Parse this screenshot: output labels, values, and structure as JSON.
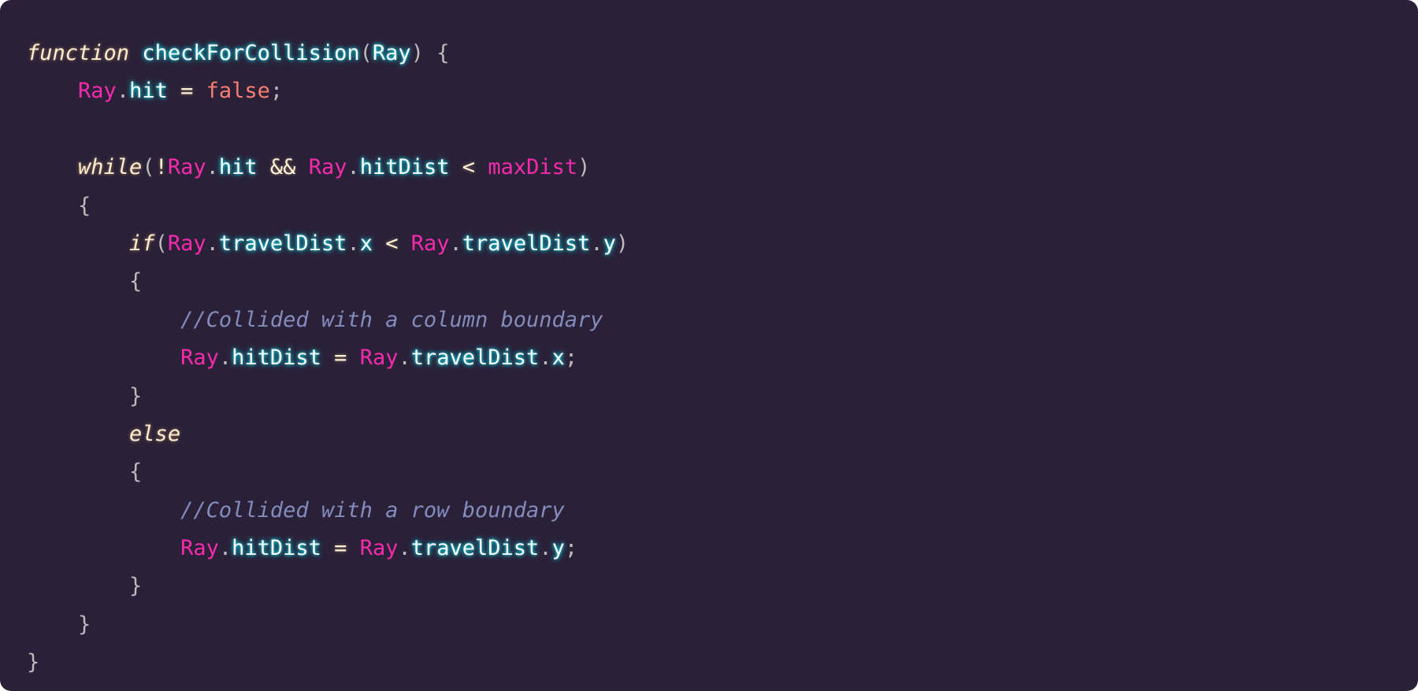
{
  "code": {
    "lines": [
      [
        {
          "t": "function",
          "c": "kw"
        },
        {
          "t": " ",
          "c": "punc"
        },
        {
          "t": "checkForCollision",
          "c": "fn"
        },
        {
          "t": "(",
          "c": "punc"
        },
        {
          "t": "Ray",
          "c": "param"
        },
        {
          "t": ") {",
          "c": "punc"
        }
      ],
      [
        {
          "t": "    ",
          "c": "punc"
        },
        {
          "t": "Ray",
          "c": "obj"
        },
        {
          "t": ".",
          "c": "punc"
        },
        {
          "t": "hit",
          "c": "prop"
        },
        {
          "t": " = ",
          "c": "op"
        },
        {
          "t": "false",
          "c": "bool"
        },
        {
          "t": ";",
          "c": "punc"
        }
      ],
      [],
      [
        {
          "t": "    ",
          "c": "punc"
        },
        {
          "t": "while",
          "c": "kw"
        },
        {
          "t": "(",
          "c": "punc"
        },
        {
          "t": "!",
          "c": "op"
        },
        {
          "t": "Ray",
          "c": "obj"
        },
        {
          "t": ".",
          "c": "punc"
        },
        {
          "t": "hit",
          "c": "prop"
        },
        {
          "t": " && ",
          "c": "op"
        },
        {
          "t": "Ray",
          "c": "obj"
        },
        {
          "t": ".",
          "c": "punc"
        },
        {
          "t": "hitDist",
          "c": "prop"
        },
        {
          "t": " < ",
          "c": "op"
        },
        {
          "t": "maxDist",
          "c": "ident"
        },
        {
          "t": ")",
          "c": "punc"
        }
      ],
      [
        {
          "t": "    {",
          "c": "punc"
        }
      ],
      [
        {
          "t": "        ",
          "c": "punc"
        },
        {
          "t": "if",
          "c": "kw"
        },
        {
          "t": "(",
          "c": "punc"
        },
        {
          "t": "Ray",
          "c": "obj"
        },
        {
          "t": ".",
          "c": "punc"
        },
        {
          "t": "travelDist",
          "c": "prop"
        },
        {
          "t": ".",
          "c": "punc"
        },
        {
          "t": "x",
          "c": "prop"
        },
        {
          "t": " < ",
          "c": "op"
        },
        {
          "t": "Ray",
          "c": "obj"
        },
        {
          "t": ".",
          "c": "punc"
        },
        {
          "t": "travelDist",
          "c": "prop"
        },
        {
          "t": ".",
          "c": "punc"
        },
        {
          "t": "y",
          "c": "prop"
        },
        {
          "t": ")",
          "c": "punc"
        }
      ],
      [
        {
          "t": "        {",
          "c": "punc"
        }
      ],
      [
        {
          "t": "            ",
          "c": "punc"
        },
        {
          "t": "//Collided with a column boundary",
          "c": "comment"
        }
      ],
      [
        {
          "t": "            ",
          "c": "punc"
        },
        {
          "t": "Ray",
          "c": "obj"
        },
        {
          "t": ".",
          "c": "punc"
        },
        {
          "t": "hitDist",
          "c": "prop"
        },
        {
          "t": " = ",
          "c": "op"
        },
        {
          "t": "Ray",
          "c": "obj"
        },
        {
          "t": ".",
          "c": "punc"
        },
        {
          "t": "travelDist",
          "c": "prop"
        },
        {
          "t": ".",
          "c": "punc"
        },
        {
          "t": "x",
          "c": "prop"
        },
        {
          "t": ";",
          "c": "punc"
        }
      ],
      [
        {
          "t": "        }",
          "c": "punc"
        }
      ],
      [
        {
          "t": "        ",
          "c": "punc"
        },
        {
          "t": "else",
          "c": "kw"
        }
      ],
      [
        {
          "t": "        {",
          "c": "punc"
        }
      ],
      [
        {
          "t": "            ",
          "c": "punc"
        },
        {
          "t": "//Collided with a row boundary",
          "c": "comment"
        }
      ],
      [
        {
          "t": "            ",
          "c": "punc"
        },
        {
          "t": "Ray",
          "c": "obj"
        },
        {
          "t": ".",
          "c": "punc"
        },
        {
          "t": "hitDist",
          "c": "prop"
        },
        {
          "t": " = ",
          "c": "op"
        },
        {
          "t": "Ray",
          "c": "obj"
        },
        {
          "t": ".",
          "c": "punc"
        },
        {
          "t": "travelDist",
          "c": "prop"
        },
        {
          "t": ".",
          "c": "punc"
        },
        {
          "t": "y",
          "c": "prop"
        },
        {
          "t": ";",
          "c": "punc"
        }
      ],
      [
        {
          "t": "        }",
          "c": "punc"
        }
      ],
      [
        {
          "t": "    }",
          "c": "punc"
        }
      ],
      [
        {
          "t": "}",
          "c": "punc"
        }
      ]
    ]
  },
  "theme": {
    "background": "#2a2139",
    "keyword": "#fdeed0",
    "object": "#f92aad",
    "property": "#fdfdfd",
    "property_glow": "#03edf9",
    "boolean": "#f97e72",
    "comment": "#848bbd",
    "punctuation": "#bbbbbb"
  }
}
